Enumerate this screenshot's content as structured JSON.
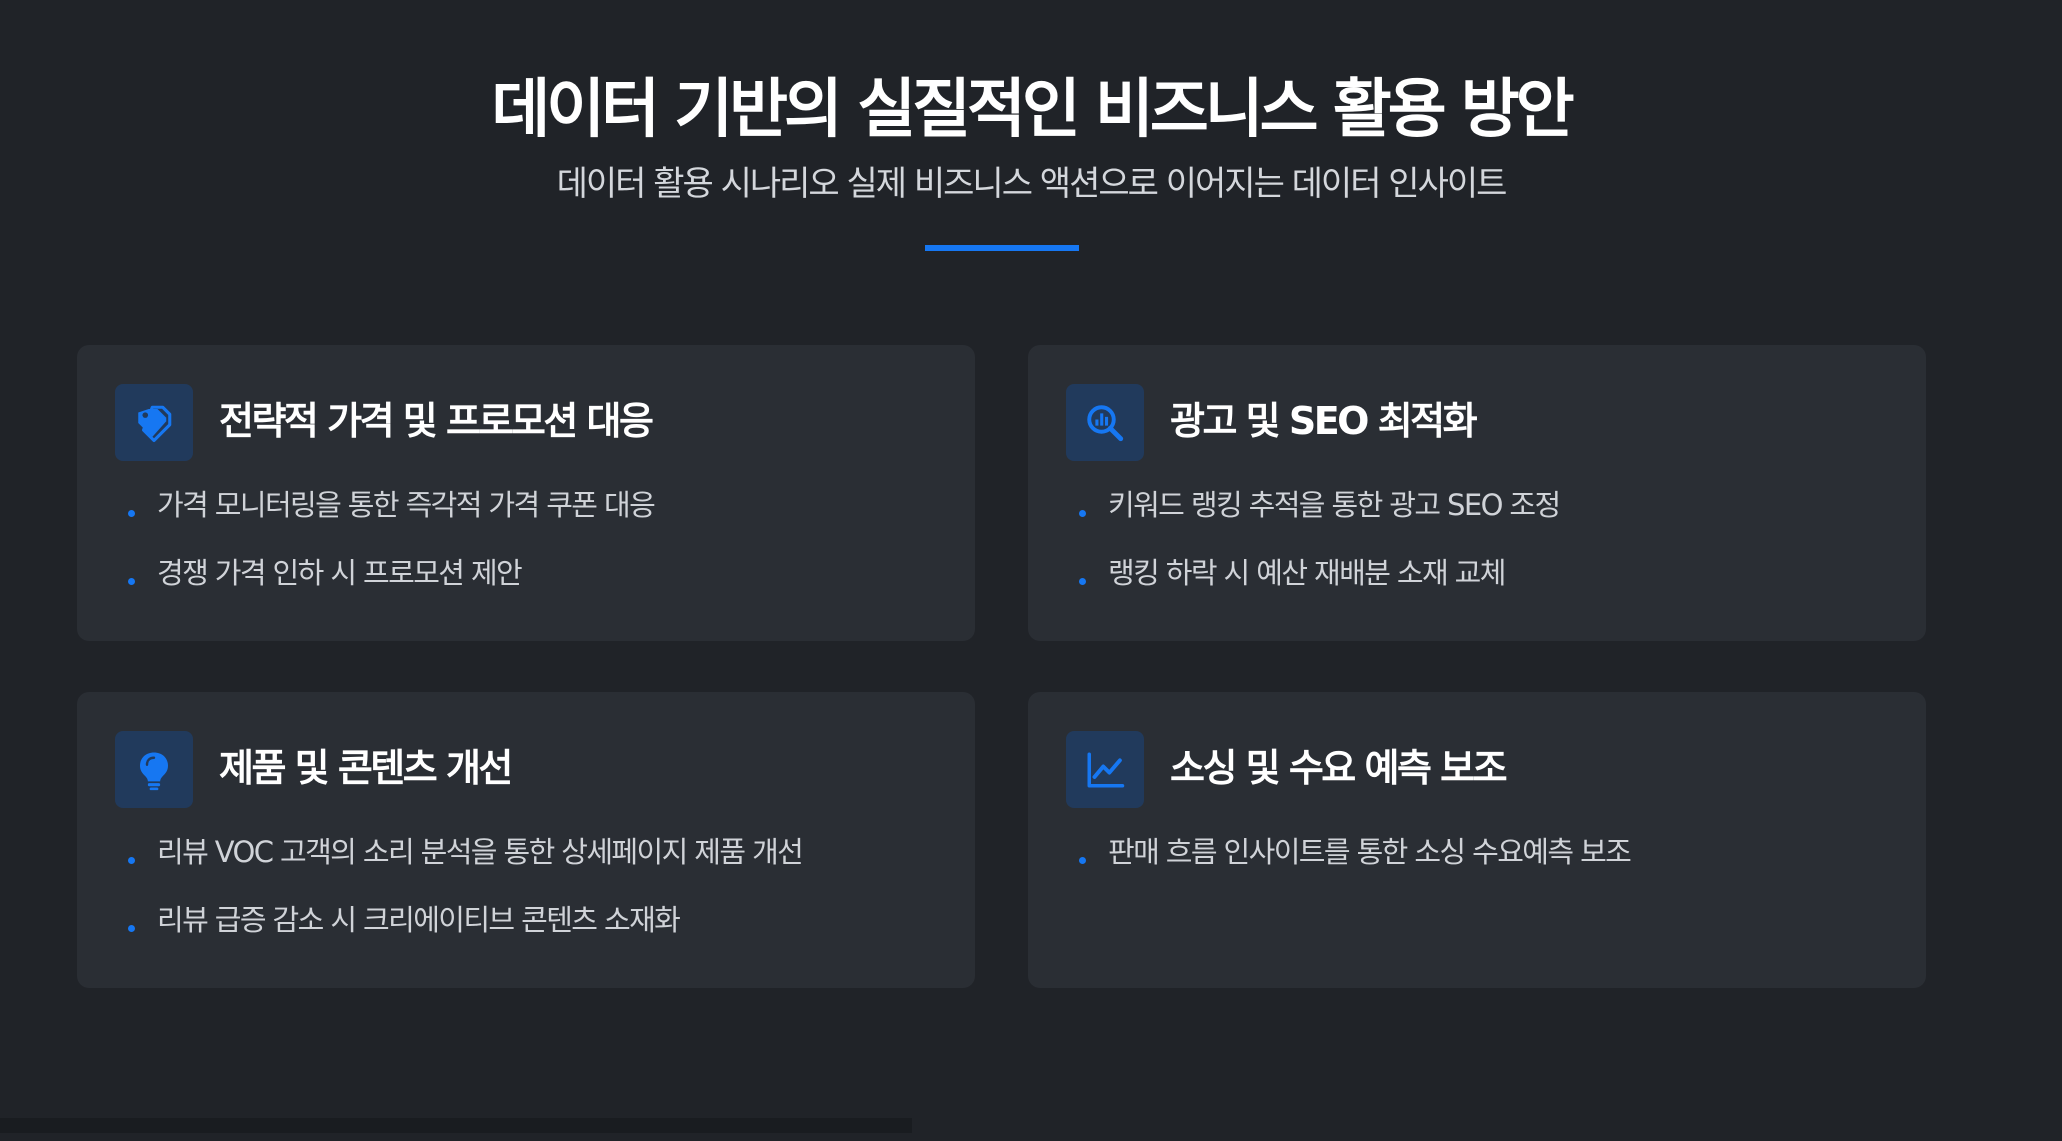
{
  "header": {
    "title": "데이터 기반의 실질적인 비즈니스 활용 방안",
    "subtitle": "데이터 활용 시나리오 실제 비즈니스 액션으로 이어지는 데이터 인사이트"
  },
  "colors": {
    "accent": "#1677f2",
    "background": "#202328",
    "card": "#2a2e34",
    "icon_bg": "#213a5c"
  },
  "cards": [
    {
      "icon": "tags-icon",
      "title": "전략적 가격 및 프로모션 대응",
      "bullets": [
        "가격 모니터링을 통한 즉각적 가격 쿠폰 대응",
        "경쟁 가격 인하 시 프로모션 제안"
      ]
    },
    {
      "icon": "search-chart-icon",
      "title": "광고 및 SEO 최적화",
      "bullets": [
        "키워드 랭킹 추적을 통한 광고 SEO 조정",
        "랭킹 하락 시 예산 재배분 소재 교체"
      ]
    },
    {
      "icon": "lightbulb-icon",
      "title": "제품 및 콘텐츠 개선",
      "bullets": [
        "리뷰 VOC 고객의 소리 분석을 통한 상세페이지 제품 개선",
        "리뷰 급증 감소 시 크리에이티브 콘텐츠 소재화"
      ]
    },
    {
      "icon": "line-chart-icon",
      "title": "소싱 및 수요 예측 보조",
      "bullets": [
        "판매 흐름 인사이트를 통한 소싱 수요예측 보조"
      ]
    }
  ]
}
